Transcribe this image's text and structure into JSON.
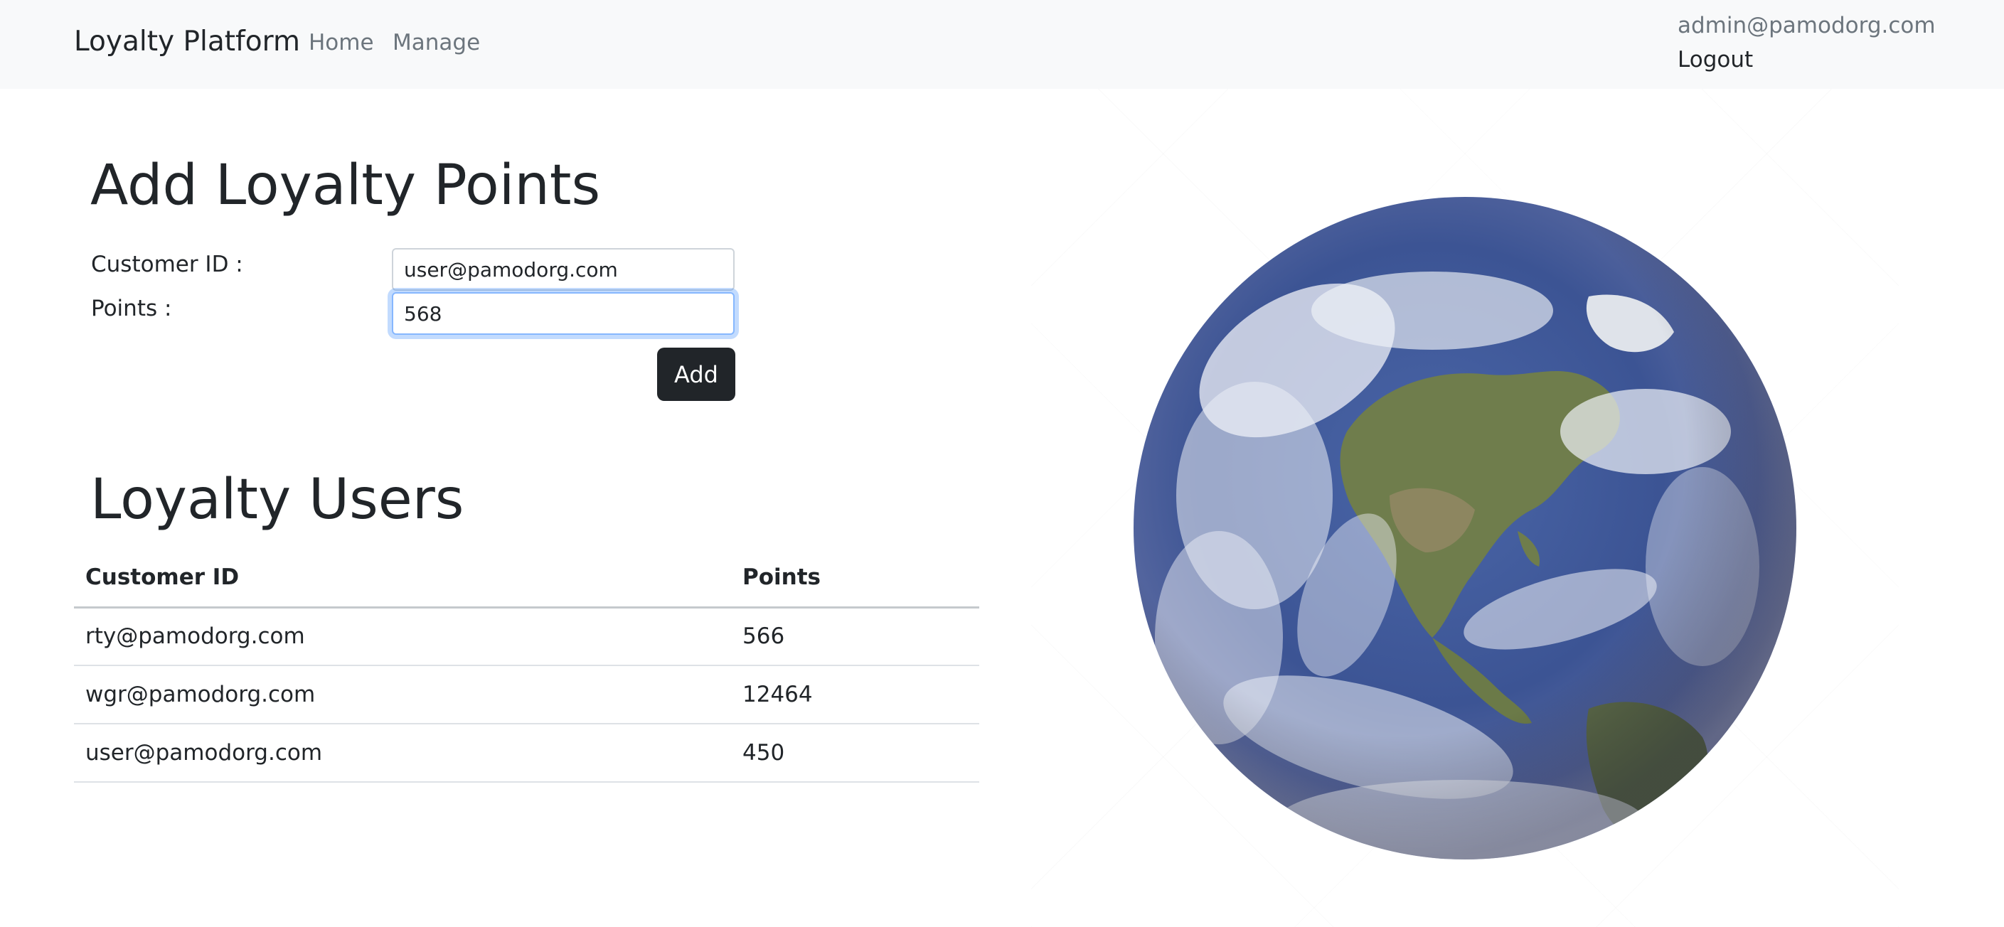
{
  "navbar": {
    "brand": "Loyalty Platform",
    "links": [
      "Home",
      "Manage"
    ],
    "user_email": "admin@pamodorg.com",
    "logout_label": "Logout"
  },
  "add_form": {
    "title": "Add Loyalty Points",
    "customer_id_label": "Customer ID :",
    "customer_id_value": "user@pamodorg.com",
    "points_label": "Points :",
    "points_value": "568",
    "add_button_label": "Add"
  },
  "users_table": {
    "title": "Loyalty Users",
    "columns": [
      "Customer ID",
      "Points"
    ],
    "rows": [
      {
        "customer_id": "rty@pamodorg.com",
        "points": "566"
      },
      {
        "customer_id": "wgr@pamodorg.com",
        "points": "12464"
      },
      {
        "customer_id": "user@pamodorg.com",
        "points": "450"
      }
    ]
  },
  "image": {
    "icon": "earth-globe-image"
  },
  "colors": {
    "navbar_bg": "#f8f9fa",
    "button_bg": "#212529",
    "focus_ring": "#86b7fe"
  }
}
